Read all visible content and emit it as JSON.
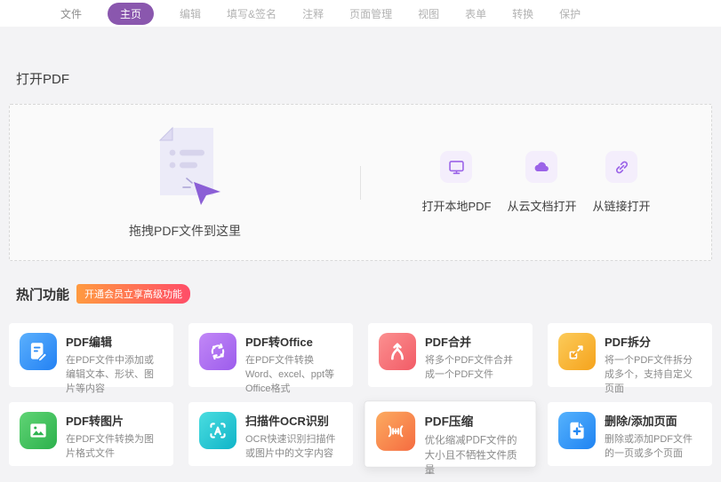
{
  "app": {
    "background_color": "#f3f3f5",
    "accent_color": "#8a57ae",
    "purple_icon_color": "#9b63e8"
  },
  "menu": {
    "items": [
      {
        "label": "文件",
        "active": false
      },
      {
        "label": "主页",
        "active": true
      },
      {
        "label": "编辑",
        "active": false
      },
      {
        "label": "填写&签名",
        "active": false
      },
      {
        "label": "注释",
        "active": false
      },
      {
        "label": "页面管理",
        "active": false
      },
      {
        "label": "视图",
        "active": false
      },
      {
        "label": "表单",
        "active": false
      },
      {
        "label": "转换",
        "active": false
      },
      {
        "label": "保护",
        "active": false
      }
    ]
  },
  "open_pdf": {
    "title": "打开PDF",
    "drop_zone": {
      "label": "拖拽PDF文件到这里",
      "icon": "document-drop-icon"
    },
    "options": [
      {
        "label": "打开本地PDF",
        "icon": "monitor-icon"
      },
      {
        "label": "从云文档打开",
        "icon": "cloud-icon"
      },
      {
        "label": "从链接打开",
        "icon": "link-icon"
      }
    ]
  },
  "hot_features": {
    "title": "热门功能",
    "badge": {
      "label": "开通会员立享高级功能",
      "gradient": [
        "#ff9a40",
        "#ff4d68"
      ]
    },
    "cards": [
      {
        "title": "PDF编辑",
        "desc": "在PDF文件中添加或编辑文本、形状、图片等内容",
        "icon": "document-edit-icon",
        "color": "#2e8cf6"
      },
      {
        "title": "PDF转Office",
        "desc": "在PDF文件转换Word、excel、ppt等Office格式",
        "icon": "convert-office-icon",
        "color": "#a468ef"
      },
      {
        "title": "PDF合并",
        "desc": "将多个PDF文件合并成一个PDF文件",
        "icon": "merge-icon",
        "color": "#f66a6f"
      },
      {
        "title": "PDF拆分",
        "desc": "将一个PDF文件拆分成多个，支持自定义页面",
        "icon": "split-icon",
        "color": "#f6a31e"
      },
      {
        "title": "PDF转图片",
        "desc": "在PDF文件转换为图片格式文件",
        "icon": "image-icon",
        "color": "#2fb351"
      },
      {
        "title": "扫描件OCR识别",
        "desc": "OCR快速识别扫描件或图片中的文字内容",
        "icon": "ocr-icon",
        "color": "#17bcca"
      },
      {
        "title": "PDF压缩",
        "desc": "优化缩减PDF文件的大小且不牺牲文件质量",
        "icon": "compress-icon",
        "color": "#f7764a",
        "hovered": true
      },
      {
        "title": "删除/添加页面",
        "desc": "删除或添加PDF文件的一页或多个页面",
        "icon": "add-remove-page-icon",
        "color": "#2389f4"
      }
    ]
  }
}
